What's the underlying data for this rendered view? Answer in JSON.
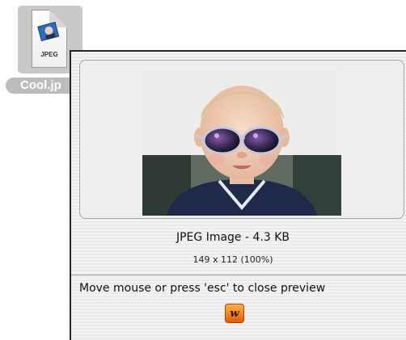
{
  "desktop": {
    "file": {
      "name": "Cool.jp",
      "type_badge": "JPEG",
      "icon": "jpeg-document-icon"
    }
  },
  "preview": {
    "title": "JPEG Image - 4.3 KB",
    "dimensions": "149 x 112 (100%)",
    "close_hint": "Move mouse or press 'esc' to close preview",
    "app_icon": "w-app-icon"
  },
  "colors": {
    "panel_border": "#262626",
    "app_icon_orange": "#f07a00"
  }
}
